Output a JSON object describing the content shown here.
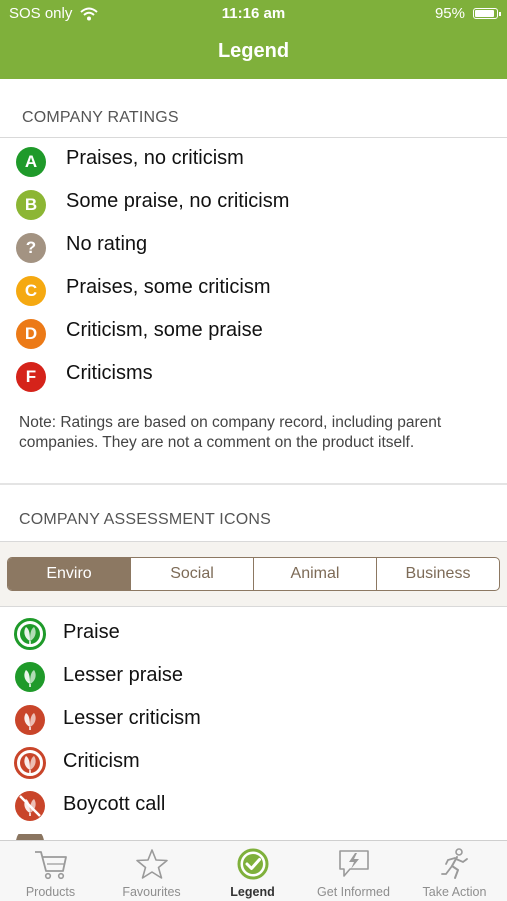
{
  "status_bar": {
    "carrier": "SOS only",
    "time": "11:16 am",
    "battery": "95%",
    "battery_level": 0.95
  },
  "nav": {
    "title": "Legend"
  },
  "ratings_section": {
    "header": "COMPANY RATINGS",
    "items": [
      {
        "grade": "A",
        "label": "Praises, no criticism",
        "color": "#1f9a2a"
      },
      {
        "grade": "B",
        "label": "Some praise, no criticism",
        "color": "#8cb634"
      },
      {
        "grade": "?",
        "label": "No rating",
        "color": "#a39382"
      },
      {
        "grade": "C",
        "label": "Praises, some criticism",
        "color": "#f5a911"
      },
      {
        "grade": "D",
        "label": "Criticism, some praise",
        "color": "#ec7a17"
      },
      {
        "grade": "F",
        "label": "Criticisms",
        "color": "#d5231a"
      }
    ],
    "note": "Note: Ratings are based on company record, including parent companies. They are not a comment on the product itself."
  },
  "assessment_section": {
    "header": "COMPANY ASSESSMENT ICONS",
    "tabs": [
      {
        "label": "Enviro",
        "active": true
      },
      {
        "label": "Social",
        "active": false
      },
      {
        "label": "Animal",
        "active": false
      },
      {
        "label": "Business",
        "active": false
      }
    ],
    "items": [
      {
        "icon": "leaf-praise-icon",
        "label": "Praise",
        "color": "#1f9a2a"
      },
      {
        "icon": "leaf-lesser-praise-icon",
        "label": "Lesser praise",
        "color": "#1f9a2a"
      },
      {
        "icon": "leaf-lesser-criticism-icon",
        "label": "Lesser criticism",
        "color": "#c9452a"
      },
      {
        "icon": "leaf-criticism-icon",
        "label": "Criticism",
        "color": "#c9452a"
      },
      {
        "icon": "leaf-boycott-icon",
        "label": "Boycott call",
        "color": "#c9452a"
      }
    ]
  },
  "tab_bar": {
    "items": [
      {
        "icon": "cart-icon",
        "label": "Products",
        "active": false
      },
      {
        "icon": "star-icon",
        "label": "Favourites",
        "active": false
      },
      {
        "icon": "check-circle-icon",
        "label": "Legend",
        "active": true
      },
      {
        "icon": "lightning-bubble-icon",
        "label": "Get Informed",
        "active": false
      },
      {
        "icon": "runner-icon",
        "label": "Take Action",
        "active": false
      }
    ]
  },
  "colors": {
    "brand_green": "#7fb03b",
    "segment_brown": "#8c7862"
  }
}
